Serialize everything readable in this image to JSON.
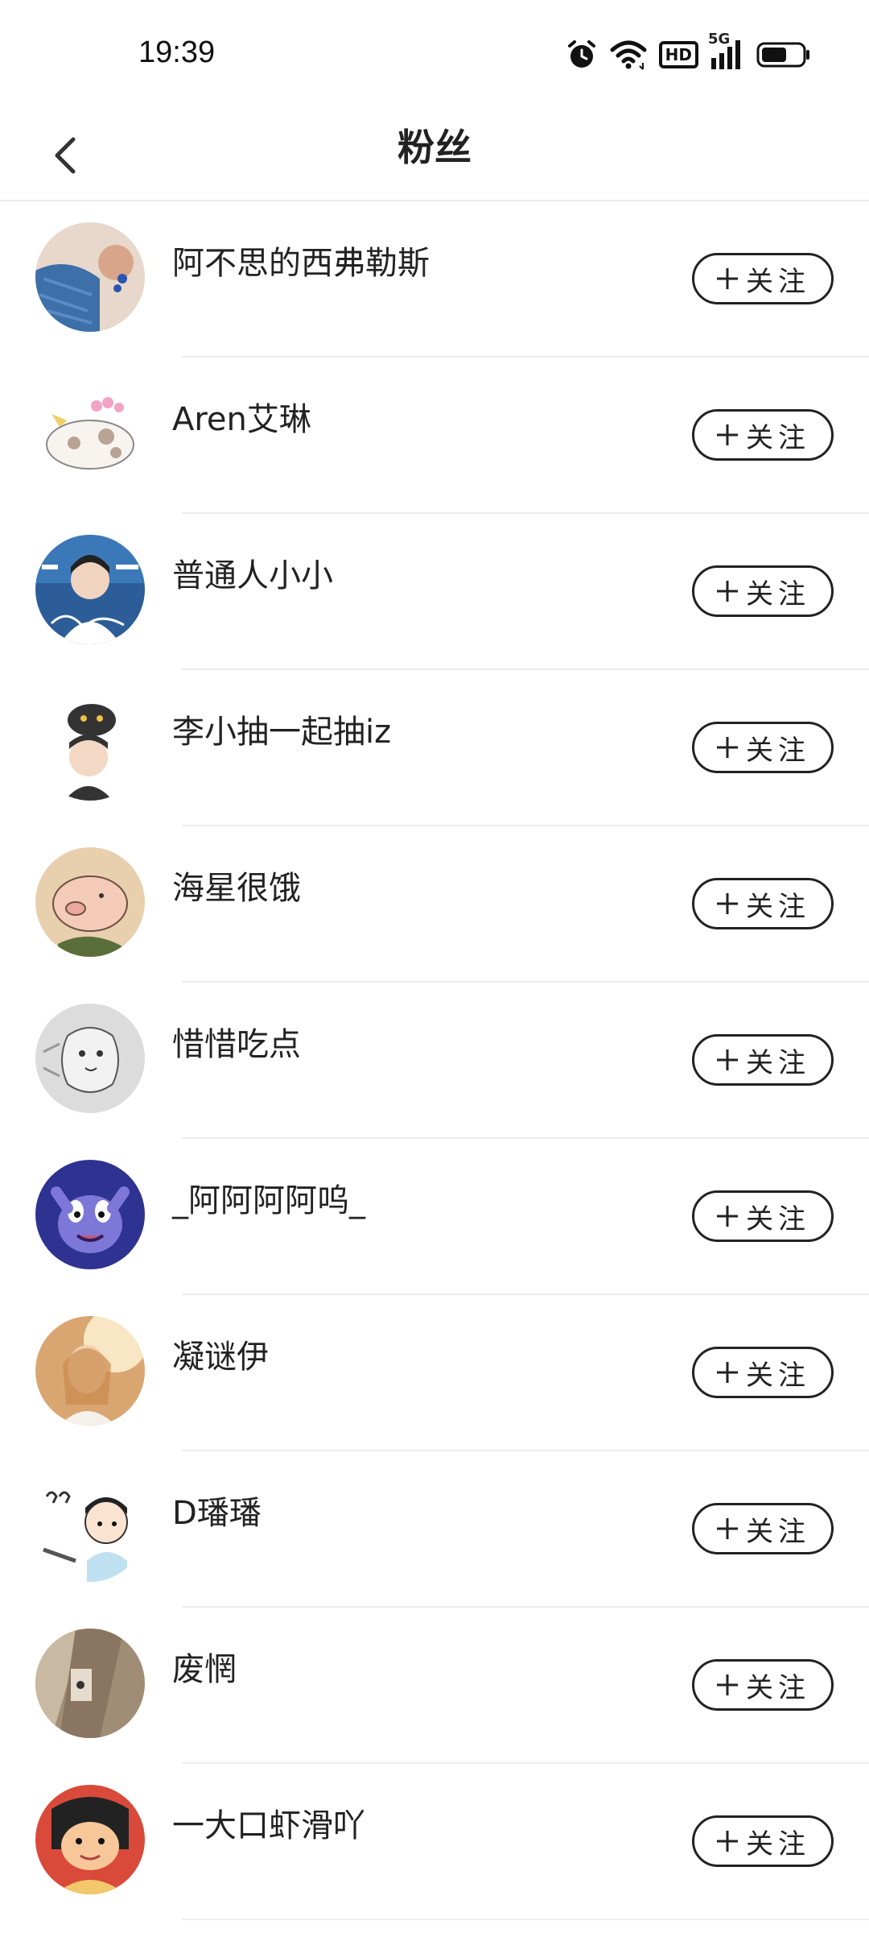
{
  "status_bar": {
    "time": "19:39",
    "icons": [
      "alarm-icon",
      "wifi-icon",
      "hd-icon",
      "signal-5g-icon",
      "battery-icon"
    ],
    "hd_label": "HD",
    "network_label": "5G"
  },
  "header": {
    "title": "粉丝",
    "back_icon": "chevron-left-icon"
  },
  "follow_label": "关注",
  "fans": [
    {
      "name": "阿不思的西弗勒斯",
      "follow_label": "关注",
      "avatar_color": "#3d6fa8"
    },
    {
      "name": "Aren艾琳",
      "follow_label": "关注",
      "avatar_color": "#f3f3f3"
    },
    {
      "name": "普通人小小",
      "follow_label": "关注",
      "avatar_color": "#2c5d99"
    },
    {
      "name": "李小抽一起抽iz",
      "follow_label": "关注",
      "avatar_color": "#ffffff"
    },
    {
      "name": "海星很饿",
      "follow_label": "关注",
      "avatar_color": "#e8c9a6"
    },
    {
      "name": "惜惜吃点",
      "follow_label": "关注",
      "avatar_color": "#d9d9d9"
    },
    {
      "name": "_阿阿阿阿呜_",
      "follow_label": "关注",
      "avatar_color": "#3b3f9c"
    },
    {
      "name": "凝谜伊",
      "follow_label": "关注",
      "avatar_color": "#e6b989"
    },
    {
      "name": "D璠璠",
      "follow_label": "关注",
      "avatar_color": "#ffffff"
    },
    {
      "name": "废惘",
      "follow_label": "关注",
      "avatar_color": "#9c8a74"
    },
    {
      "name": "一大口虾滑吖",
      "follow_label": "关注",
      "avatar_color": "#f2c86a"
    }
  ]
}
